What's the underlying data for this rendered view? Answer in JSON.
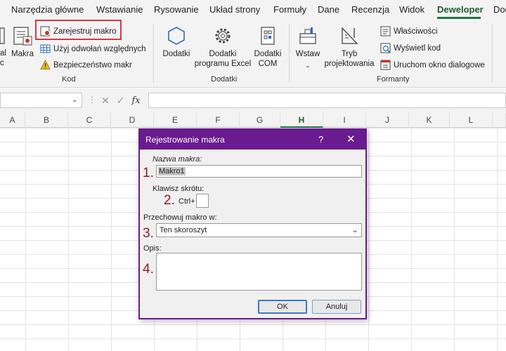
{
  "tabs": [
    "Narzędzia główne",
    "Wstawianie",
    "Rysowanie",
    "Układ strony",
    "Formuły",
    "Dane",
    "Recenzja",
    "Widok",
    "Deweloper",
    "Dod"
  ],
  "active_tab": "Deweloper",
  "ribbon": {
    "kod_group": {
      "left_cut_top": "al",
      "left_cut_bottom": "c",
      "macros_label": "Makra",
      "record_macro": "Zarejestruj makro",
      "relative_refs": "Użyj odwołań względnych",
      "macro_security": "Bezpieczeństwo makr",
      "group_label": "Kod"
    },
    "dodatki_group": {
      "addins": "Dodatki",
      "excel_addins_line1": "Dodatki",
      "excel_addins_line2": "programu Excel",
      "com_addins_line1": "Dodatki",
      "com_addins_line2": "COM",
      "group_label": "Dodatki"
    },
    "formanty_group": {
      "insert": "Wstaw",
      "design_mode_line1": "Tryb",
      "design_mode_line2": "projektowania",
      "properties": "Właściwości",
      "view_code": "Wyświetl kod",
      "run_dialog": "Uruchom okno dialogowe",
      "group_label": "Formanty"
    }
  },
  "formula_bar": {
    "fx_label": "fx"
  },
  "columns": [
    "A",
    "B",
    "C",
    "D",
    "E",
    "F",
    "G",
    "H",
    "I",
    "J",
    "K",
    "L"
  ],
  "selected_column": "H",
  "dialog": {
    "title": "Rejestrowanie makra",
    "help": "?",
    "close": "✕",
    "macro_name_label": "Nazwa makra:",
    "macro_name_value": "Makro1",
    "shortcut_label": "Klawisz skrótu:",
    "ctrl_label": "Ctrl+",
    "shortcut_value": "",
    "store_label": "Przechowuj makro w:",
    "store_value": "Ten skoroszyt",
    "description_label": "Opis:",
    "description_value": "",
    "ok": "OK",
    "cancel": "Anuluj",
    "step_numbers": [
      "1.",
      "2.",
      "3.",
      "4."
    ]
  }
}
